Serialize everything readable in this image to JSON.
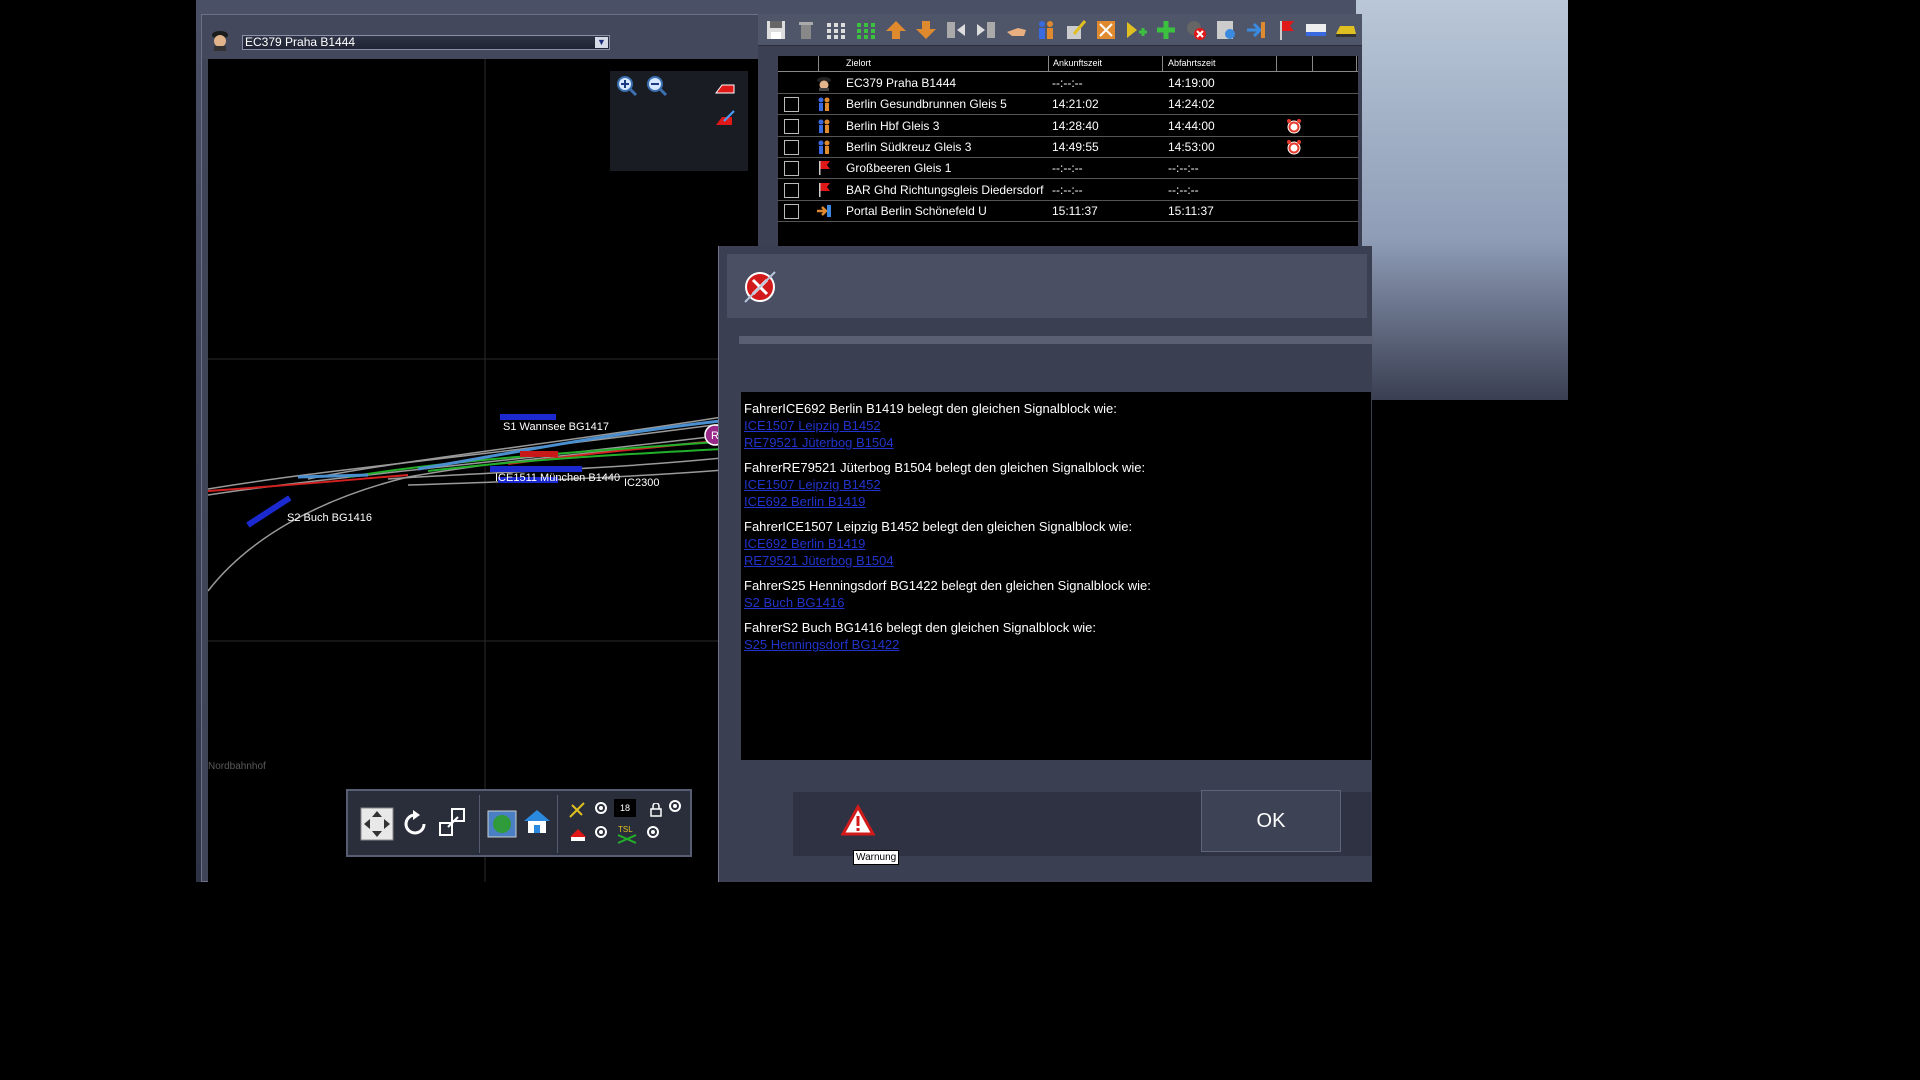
{
  "map": {
    "train_select": "EC379 Praha B1444",
    "labels": {
      "s1": "S1 Wannsee BG1417",
      "ice": "ICE1511 München B1440",
      "ic": "IC2300",
      "s2": "S2 Buch BG1416",
      "station": "Nordbahnhof"
    }
  },
  "timetable": {
    "headers": {
      "dest": "Zielort",
      "arr": "Ankunftszeit",
      "dep": "Abfahrtszeit"
    },
    "rows": [
      {
        "dest": "EC379 Praha B1444",
        "arr": "--:--:--",
        "dep": "14:19:00",
        "icon": "driver-icon",
        "checkbox": false,
        "alarm": false
      },
      {
        "dest": "Berlin Gesundbrunnen Gleis 5",
        "arr": "14:21:02",
        "dep": "14:24:02",
        "icon": "passenger-stop-icon",
        "checkbox": true,
        "alarm": false
      },
      {
        "dest": "Berlin Hbf Gleis 3",
        "arr": "14:28:40",
        "dep": "14:44:00",
        "icon": "passenger-stop-icon",
        "checkbox": true,
        "alarm": true
      },
      {
        "dest": "Berlin Südkreuz Gleis 3",
        "arr": "14:49:55",
        "dep": "14:53:00",
        "icon": "passenger-stop-icon",
        "checkbox": true,
        "alarm": true
      },
      {
        "dest": "Großbeeren Gleis 1",
        "arr": "--:--:--",
        "dep": "--:--:--",
        "icon": "flag-icon",
        "checkbox": true,
        "alarm": false
      },
      {
        "dest": "BAR Ghd Richtungsgleis Diedersdorf",
        "arr": "--:--:--",
        "dep": "--:--:--",
        "icon": "flag-icon",
        "checkbox": true,
        "alarm": false
      },
      {
        "dest": "Portal Berlin Schönefeld U",
        "arr": "15:11:37",
        "dep": "15:11:37",
        "icon": "portal-icon",
        "checkbox": true,
        "alarm": false
      }
    ]
  },
  "dialog": {
    "messages": [
      {
        "text": "FahrerICE692 Berlin B1419 belegt den gleichen Signalblock wie:",
        "links": [
          "ICE1507 Leipzig B1452",
          "RE79521 Jüterbog B1504"
        ]
      },
      {
        "text": "FahrerRE79521 Jüterbog B1504 belegt den gleichen Signalblock wie:",
        "links": [
          "ICE1507 Leipzig B1452",
          "ICE692 Berlin B1419"
        ]
      },
      {
        "text": "FahrerICE1507 Leipzig B1452 belegt den gleichen Signalblock wie:",
        "links": [
          "ICE692 Berlin B1419",
          "RE79521 Jüterbog B1504"
        ]
      },
      {
        "text": "FahrerS25 Henningsdorf BG1422 belegt den gleichen Signalblock wie:",
        "links": [
          "S2 Buch BG1416"
        ]
      },
      {
        "text": "FahrerS2 Buch BG1416 belegt den gleichen Signalblock wie:",
        "links": [
          "S25 Henningsdorf BG1422"
        ]
      }
    ],
    "warning_tooltip": "Warnung",
    "ok_label": "OK"
  },
  "toolbar_small": {
    "value": "18"
  }
}
